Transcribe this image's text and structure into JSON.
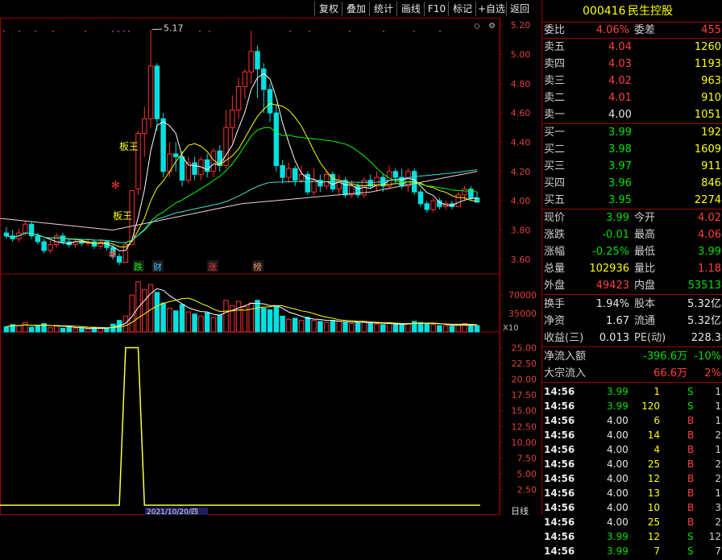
{
  "toolbar": {
    "buttons": [
      "复权",
      "叠加",
      "统计",
      "画线",
      "F10",
      "标记",
      "+自选",
      "返回"
    ]
  },
  "stock": {
    "code": "000416",
    "name": "民生控股"
  },
  "order_ratio": {
    "label": "委比",
    "value": "4.06%",
    "diff_label": "委差",
    "diff_value": "455"
  },
  "asks": [
    {
      "label": "卖五",
      "price": "4.04",
      "vol": "1260"
    },
    {
      "label": "卖四",
      "price": "4.03",
      "vol": "1193"
    },
    {
      "label": "卖三",
      "price": "4.02",
      "vol": "963"
    },
    {
      "label": "卖二",
      "price": "4.01",
      "vol": "910"
    },
    {
      "label": "卖一",
      "price": "4.00",
      "vol": "1051"
    }
  ],
  "bids": [
    {
      "label": "买一",
      "price": "3.99",
      "vol": "192"
    },
    {
      "label": "买二",
      "price": "3.98",
      "vol": "1609"
    },
    {
      "label": "买三",
      "price": "3.97",
      "vol": "911"
    },
    {
      "label": "买四",
      "price": "3.96",
      "vol": "846"
    },
    {
      "label": "买五",
      "price": "3.95",
      "vol": "2274"
    }
  ],
  "quote": [
    {
      "l1": "现价",
      "v1": "3.99",
      "l2": "今开",
      "v2": "4.02"
    },
    {
      "l1": "涨跌",
      "v1": "-0.01",
      "l2": "最高",
      "v2": "4.06"
    },
    {
      "l1": "涨幅",
      "v1": "-0.25%",
      "l2": "最低",
      "v2": "3.99"
    },
    {
      "l1": "总量",
      "v1": "102936",
      "l2": "量比",
      "v2": "1.18"
    },
    {
      "l1": "外盘",
      "v1": "49423",
      "l2": "内盘",
      "v2": "53513"
    }
  ],
  "stats": [
    {
      "l1": "换手",
      "v1": "1.94%",
      "l2": "股本",
      "v2": "5.32亿"
    },
    {
      "l1": "净资",
      "v1": "1.67",
      "l2": "流通",
      "v2": "5.32亿"
    },
    {
      "l1": "收益(三)",
      "v1": "0.013",
      "l2": "PE(动)",
      "v2": "228.3"
    }
  ],
  "flows": [
    {
      "label": "净流入额",
      "value": "-396.6万",
      "pct": "-10%"
    },
    {
      "label": "大宗流入",
      "value": "66.6万",
      "pct": "2%"
    }
  ],
  "ticks": [
    {
      "time": "14:56",
      "price": "3.99",
      "vol": "1",
      "side": "S",
      "n": "1"
    },
    {
      "time": "14:56",
      "price": "3.99",
      "vol": "120",
      "side": "S",
      "n": "1"
    },
    {
      "time": "14:56",
      "price": "4.00",
      "vol": "6",
      "side": "B",
      "n": "1"
    },
    {
      "time": "14:56",
      "price": "4.00",
      "vol": "14",
      "side": "B",
      "n": "2"
    },
    {
      "time": "14:56",
      "price": "4.00",
      "vol": "4",
      "side": "B",
      "n": "1"
    },
    {
      "time": "14:56",
      "price": "4.00",
      "vol": "25",
      "side": "B",
      "n": "2"
    },
    {
      "time": "14:56",
      "price": "4.00",
      "vol": "12",
      "side": "B",
      "n": "2"
    },
    {
      "time": "14:56",
      "price": "4.00",
      "vol": "13",
      "side": "B",
      "n": "1"
    },
    {
      "time": "14:56",
      "price": "4.00",
      "vol": "10",
      "side": "B",
      "n": "3"
    },
    {
      "time": "14:56",
      "price": "4.00",
      "vol": "25",
      "side": "B",
      "n": "2"
    },
    {
      "time": "14:56",
      "price": "3.99",
      "vol": "12",
      "side": "S",
      "n": "12"
    },
    {
      "time": "14:56",
      "price": "3.99",
      "vol": "7",
      "side": "S",
      "n": "7"
    }
  ],
  "chart_labels": {
    "high_marker": "5.17",
    "banwang1": "板王",
    "banwang2": "板王",
    "events": [
      "跌",
      "财",
      "涨",
      "榜"
    ],
    "vol_mult": "X10",
    "date_tag": "2021/10/20/四",
    "period_tag": "日线"
  },
  "colors": {
    "up": "#ff3030",
    "down": "#00e0e0",
    "ma5": "#ffffff",
    "ma10": "#ffff00",
    "ma20": "#00ff00",
    "ma60": "#40e0d0",
    "border": "#9a0000"
  },
  "chart_data": {
    "type": "bar",
    "candles": [
      [
        3.78,
        3.76,
        3.82,
        3.74
      ],
      [
        3.76,
        3.74,
        3.8,
        3.72
      ],
      [
        3.74,
        3.78,
        3.81,
        3.72
      ],
      [
        3.78,
        3.84,
        3.86,
        3.76
      ],
      [
        3.84,
        3.76,
        3.86,
        3.74
      ],
      [
        3.76,
        3.72,
        3.78,
        3.7
      ],
      [
        3.72,
        3.66,
        3.74,
        3.64
      ],
      [
        3.66,
        3.7,
        3.73,
        3.64
      ],
      [
        3.7,
        3.76,
        3.78,
        3.68
      ],
      [
        3.76,
        3.72,
        3.78,
        3.7
      ],
      [
        3.72,
        3.7,
        3.74,
        3.68
      ],
      [
        3.7,
        3.72,
        3.74,
        3.68
      ],
      [
        3.72,
        3.71,
        3.74,
        3.69
      ],
      [
        3.71,
        3.72,
        3.74,
        3.69
      ],
      [
        3.72,
        3.69,
        3.73,
        3.67
      ],
      [
        3.69,
        3.72,
        3.74,
        3.67
      ],
      [
        3.72,
        3.68,
        3.73,
        3.66
      ],
      [
        3.68,
        3.62,
        3.7,
        3.6
      ],
      [
        3.62,
        3.58,
        3.64,
        3.56
      ],
      [
        3.58,
        3.7,
        3.72,
        3.58
      ],
      [
        3.7,
        4.07,
        4.07,
        3.7
      ],
      [
        4.08,
        4.46,
        4.48,
        4.04
      ],
      [
        4.46,
        4.56,
        4.64,
        4.3
      ],
      [
        4.56,
        4.92,
        5.17,
        4.5
      ],
      [
        4.92,
        4.56,
        4.94,
        4.48
      ],
      [
        4.56,
        4.2,
        4.6,
        4.16
      ],
      [
        4.2,
        4.32,
        4.4,
        4.16
      ],
      [
        4.32,
        4.3,
        4.4,
        4.2
      ],
      [
        4.3,
        4.14,
        4.34,
        4.1
      ],
      [
        4.14,
        4.26,
        4.3,
        4.12
      ],
      [
        4.26,
        4.18,
        4.3,
        4.14
      ],
      [
        4.18,
        4.28,
        4.3,
        4.14
      ],
      [
        4.28,
        4.2,
        4.32,
        4.16
      ],
      [
        4.2,
        4.34,
        4.36,
        4.16
      ],
      [
        4.34,
        4.24,
        4.38,
        4.2
      ],
      [
        4.24,
        4.5,
        4.62,
        4.22
      ],
      [
        4.5,
        4.62,
        4.72,
        4.4
      ],
      [
        4.62,
        4.78,
        4.84,
        4.56
      ],
      [
        4.78,
        4.88,
        4.9,
        4.7
      ],
      [
        4.88,
        5.02,
        5.16,
        4.8
      ],
      [
        5.02,
        4.9,
        5.06,
        4.7
      ],
      [
        4.9,
        4.76,
        4.94,
        4.6
      ],
      [
        4.76,
        4.6,
        4.8,
        4.54
      ],
      [
        4.6,
        4.24,
        4.66,
        4.2
      ],
      [
        4.24,
        4.16,
        4.28,
        4.12
      ],
      [
        4.16,
        4.22,
        4.26,
        4.12
      ],
      [
        4.22,
        4.14,
        4.24,
        4.1
      ],
      [
        4.14,
        4.18,
        4.24,
        4.12
      ],
      [
        4.18,
        4.06,
        4.2,
        4.04
      ],
      [
        4.06,
        4.14,
        4.22,
        4.04
      ],
      [
        4.14,
        4.1,
        4.18,
        4.06
      ],
      [
        4.1,
        4.18,
        4.2,
        4.08
      ],
      [
        4.18,
        4.08,
        4.2,
        4.06
      ],
      [
        4.08,
        4.14,
        4.18,
        4.04
      ],
      [
        4.14,
        4.04,
        4.16,
        4.02
      ],
      [
        4.04,
        4.1,
        4.14,
        4.02
      ],
      [
        4.1,
        4.04,
        4.12,
        4.02
      ],
      [
        4.04,
        4.14,
        4.16,
        4.02
      ],
      [
        4.14,
        4.1,
        4.18,
        4.08
      ],
      [
        4.1,
        4.16,
        4.2,
        4.06
      ],
      [
        4.16,
        4.1,
        4.18,
        4.06
      ],
      [
        4.1,
        4.2,
        4.24,
        4.08
      ],
      [
        4.2,
        4.16,
        4.22,
        4.12
      ],
      [
        4.16,
        4.1,
        4.22,
        4.08
      ],
      [
        4.1,
        4.2,
        4.22,
        4.06
      ],
      [
        4.2,
        4.06,
        4.22,
        4.04
      ],
      [
        4.06,
        3.98,
        4.08,
        3.96
      ],
      [
        3.98,
        3.94,
        4.0,
        3.92
      ],
      [
        3.94,
        4.0,
        4.02,
        3.92
      ],
      [
        4.0,
        3.96,
        4.02,
        3.94
      ],
      [
        3.96,
        3.98,
        4.0,
        3.94
      ],
      [
        3.98,
        3.96,
        4.0,
        3.94
      ],
      [
        3.96,
        4.04,
        4.06,
        3.96
      ],
      [
        4.04,
        4.08,
        4.1,
        4.0
      ],
      [
        4.08,
        4.02,
        4.1,
        4.0
      ],
      [
        4.02,
        3.99,
        4.06,
        3.99
      ]
    ],
    "y_ticks": [
      "5.20",
      "5.00",
      "4.80",
      "4.60",
      "4.40",
      "4.20",
      "4.00",
      "3.80",
      "3.60"
    ],
    "vol_ticks": [
      "70000",
      "35000"
    ],
    "ind_ticks": [
      "25.00",
      "22.50",
      "20.00",
      "17.50",
      "15.00",
      "12.50",
      "10.00",
      "7.50",
      "5.00",
      "2.50"
    ],
    "ylim": [
      3.5,
      5.25
    ]
  }
}
